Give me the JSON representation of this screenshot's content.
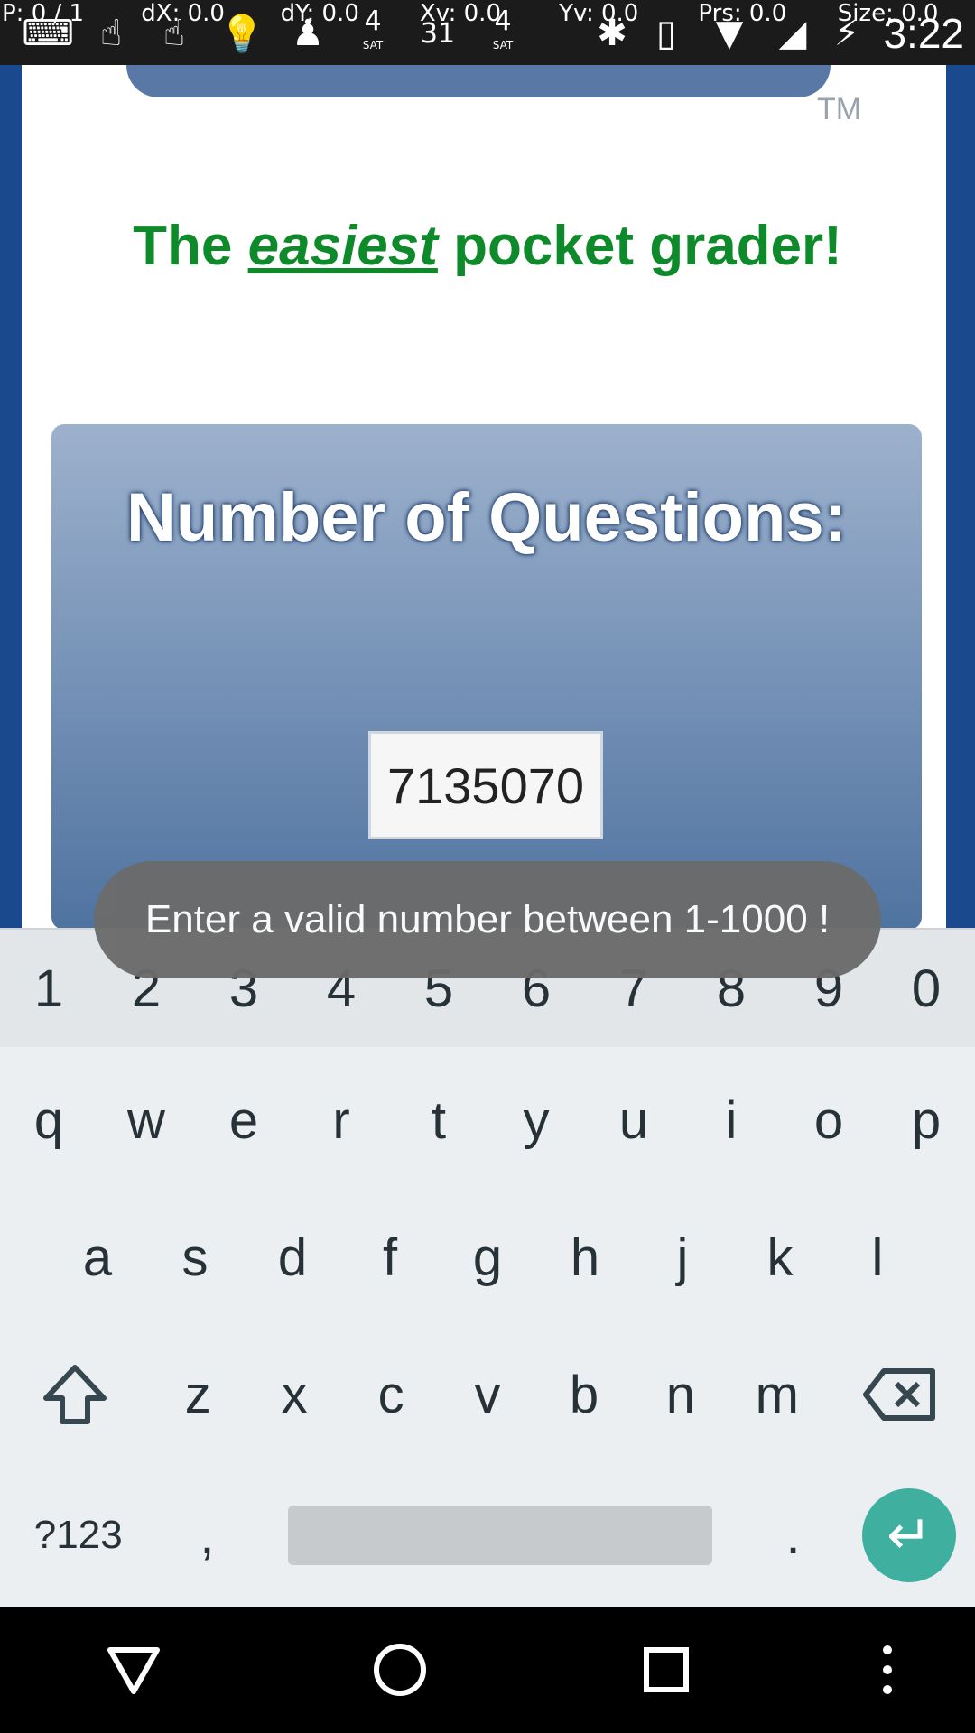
{
  "statusbar": {
    "debug": [
      "P: 0 / 1",
      "dX: 0.0",
      "dY: 0.0",
      "Xv: 0.0",
      "Yv: 0.0",
      "Prs: 0.0",
      "Size: 0.0"
    ],
    "time": "3:22",
    "sat_label": "SAT",
    "sat_count": "4",
    "calendar_day": "31"
  },
  "app": {
    "tagline_pre": "The ",
    "tagline_em": "easiest",
    "tagline_post": " pocket grader!",
    "tm": "TM",
    "card_title": "Number of Questions:",
    "input_value": "7135070"
  },
  "toast": {
    "message": "Enter a valid number between 1-1000 !"
  },
  "keyboard": {
    "numbers": [
      "1",
      "2",
      "3",
      "4",
      "5",
      "6",
      "7",
      "8",
      "9",
      "0"
    ],
    "row1": [
      "q",
      "w",
      "e",
      "r",
      "t",
      "y",
      "u",
      "i",
      "o",
      "p"
    ],
    "row2": [
      "a",
      "s",
      "d",
      "f",
      "g",
      "h",
      "j",
      "k",
      "l"
    ],
    "row3": [
      "z",
      "x",
      "c",
      "v",
      "b",
      "n",
      "m"
    ],
    "symbols_label": "?123",
    "comma": ",",
    "period": "."
  },
  "icons": {
    "status": [
      "keyboard-icon",
      "touch-icon",
      "touch-icon",
      "lightbulb-icon",
      "chess-icon",
      "satellite-icon",
      "calendar-icon",
      "satellite-icon",
      "bluetooth-icon",
      "vibrate-icon",
      "wifi-icon",
      "signal-icon",
      "battery-charging-icon"
    ],
    "nav": [
      "back-icon",
      "home-icon",
      "recents-icon",
      "menu-icon"
    ]
  },
  "colors": {
    "tagline": "#0f8a2a",
    "enter_key": "#3fb0a0",
    "card_top": "#9db1cd",
    "card_bottom": "#4f73a0"
  }
}
